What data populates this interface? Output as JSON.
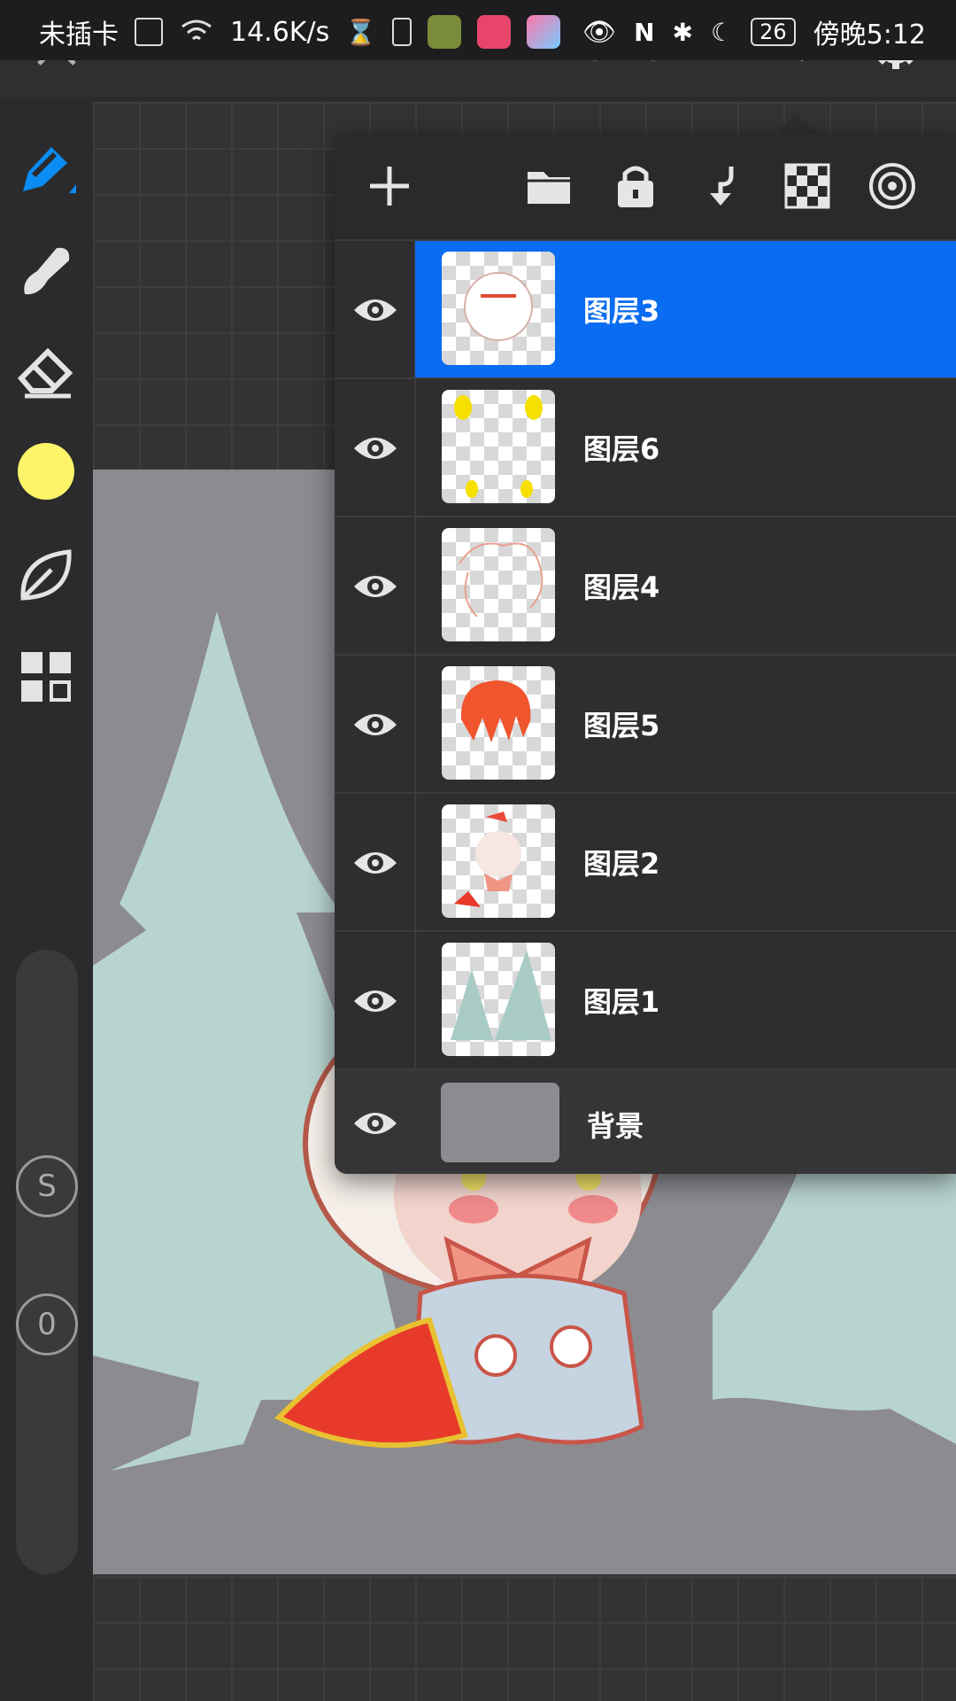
{
  "status_bar": {
    "carrier": "未插卡",
    "net_speed": "14.6K/s",
    "battery": "26",
    "time": "傍晚5:12"
  },
  "colors": {
    "accent": "#0a6cf2",
    "current_color": "#fdf46a",
    "canvas_bg": "#8c8b8f",
    "tree": "#b8d4cf"
  },
  "toolbar": {
    "tools": [
      "pen-icon",
      "brush-icon",
      "eraser-icon",
      "color-swatch",
      "leaf-icon",
      "grid-icon"
    ],
    "size_label": "S",
    "opacity_label": "0"
  },
  "layers_panel": {
    "tools": [
      "add-icon",
      "folder-icon",
      "lock-icon",
      "merge-down-icon",
      "transparency-icon",
      "blend-icon"
    ],
    "layers": [
      {
        "name": "图层3",
        "selected": true
      },
      {
        "name": "图层6",
        "selected": false
      },
      {
        "name": "图层4",
        "selected": false
      },
      {
        "name": "图层5",
        "selected": false
      },
      {
        "name": "图层2",
        "selected": false
      },
      {
        "name": "图层1",
        "selected": false
      }
    ],
    "background_layer": "背景"
  }
}
